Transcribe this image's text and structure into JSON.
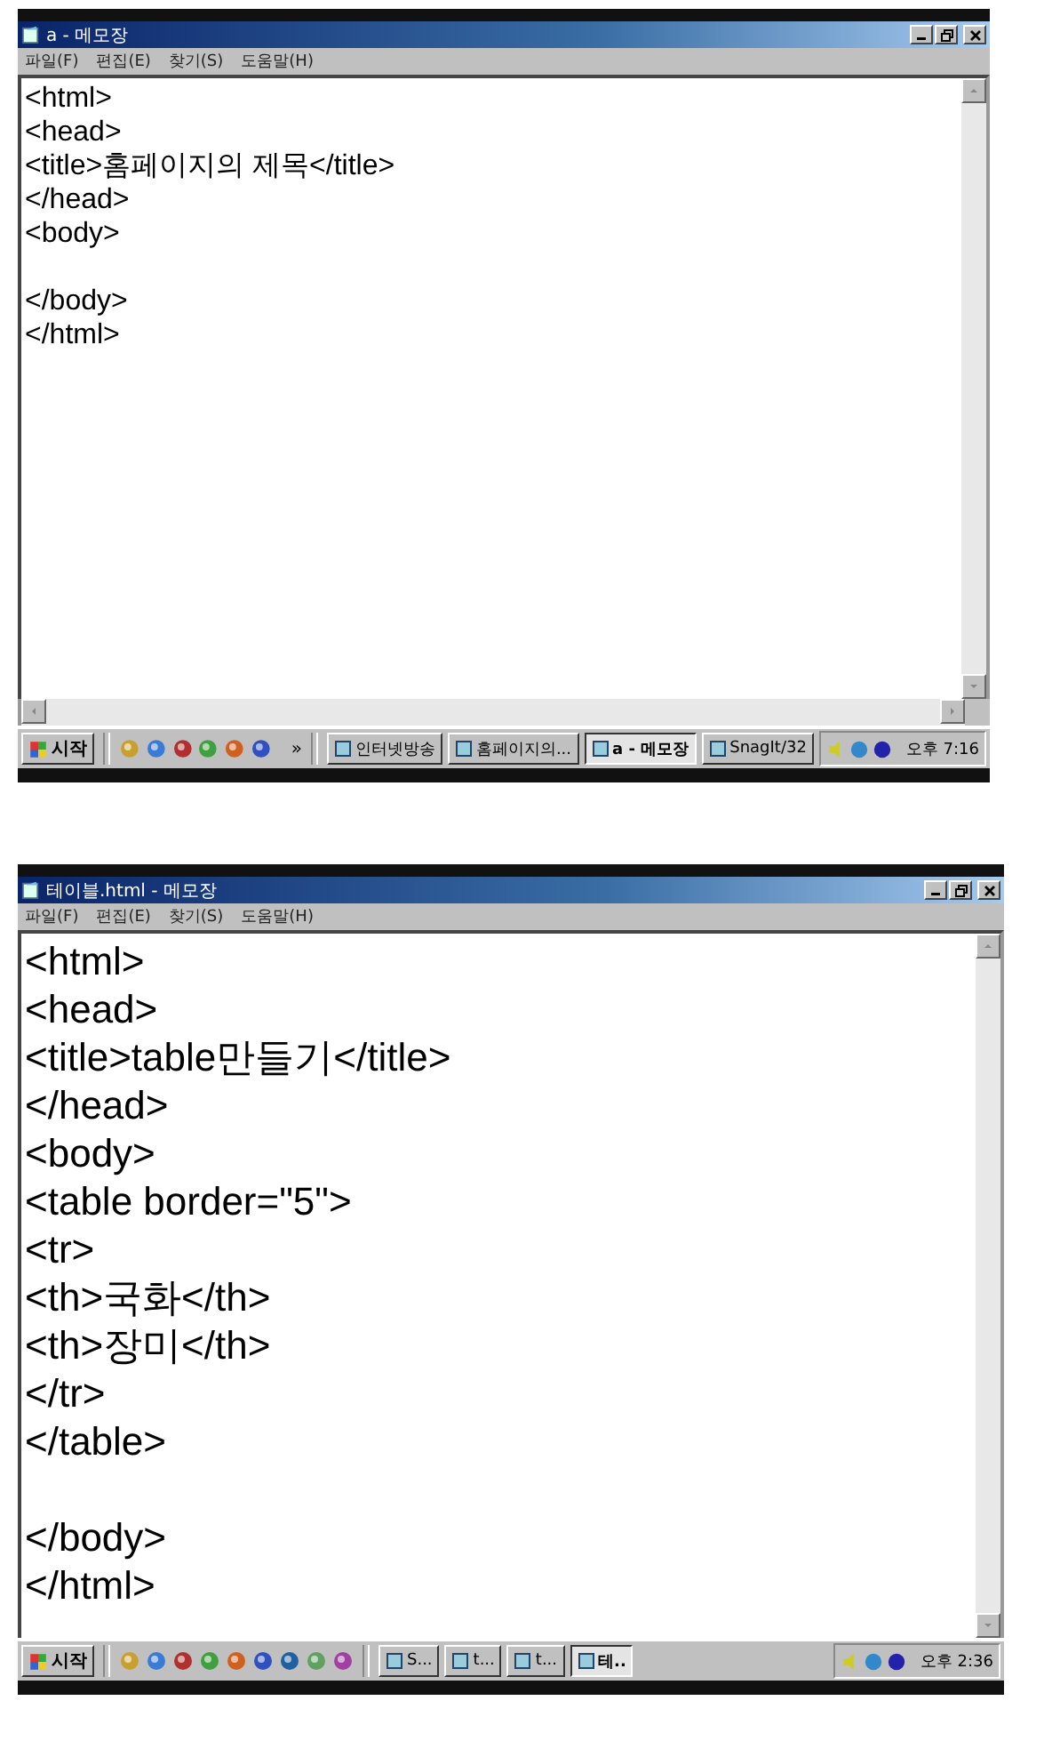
{
  "screens": [
    {
      "kind": "small",
      "window": {
        "title": "a - 메모장"
      },
      "menu": [
        "파일(F)",
        "편집(E)",
        "찾기(S)",
        "도움말(H)"
      ],
      "blocks": [
        [
          "<html>",
          "<head>",
          "<title>홈페이지의 제목</title>",
          "</head>",
          "<body>"
        ],
        [
          "</body>",
          "</html>"
        ]
      ],
      "horizontal_scrollbar": true,
      "taskbar": {
        "start": "시작",
        "quick_launch_count_overflow": "»",
        "tasks": [
          {
            "label": "인터넷방송",
            "selected": false
          },
          {
            "label": "홈페이지의...",
            "selected": false
          },
          {
            "label": "a - 메모장",
            "selected": true
          },
          {
            "label": "SnagIt/32",
            "selected": false
          }
        ],
        "clock": "오후 7:16"
      }
    },
    {
      "kind": "large",
      "window": {
        "title": "테이블.html - 메모장"
      },
      "menu": [
        "파일(F)",
        "편집(E)",
        "찾기(S)",
        "도움말(H)"
      ],
      "blocks": [
        [
          "<html>",
          "<head>",
          "<title>table만들기</title>",
          "</head>",
          "<body>",
          "<table border=\"5\">",
          "<tr>",
          "<th>국화</th>",
          "<th>장미</th>",
          "</tr>",
          "</table>"
        ],
        [
          "</body>",
          "</html>"
        ]
      ],
      "horizontal_scrollbar": false,
      "taskbar": {
        "start": "시작",
        "tasks": [
          {
            "label": "S...",
            "selected": false
          },
          {
            "label": "t...",
            "selected": false
          },
          {
            "label": "t...",
            "selected": false
          },
          {
            "label": "테..",
            "selected": true
          }
        ],
        "clock": "오후 2:36"
      }
    }
  ]
}
